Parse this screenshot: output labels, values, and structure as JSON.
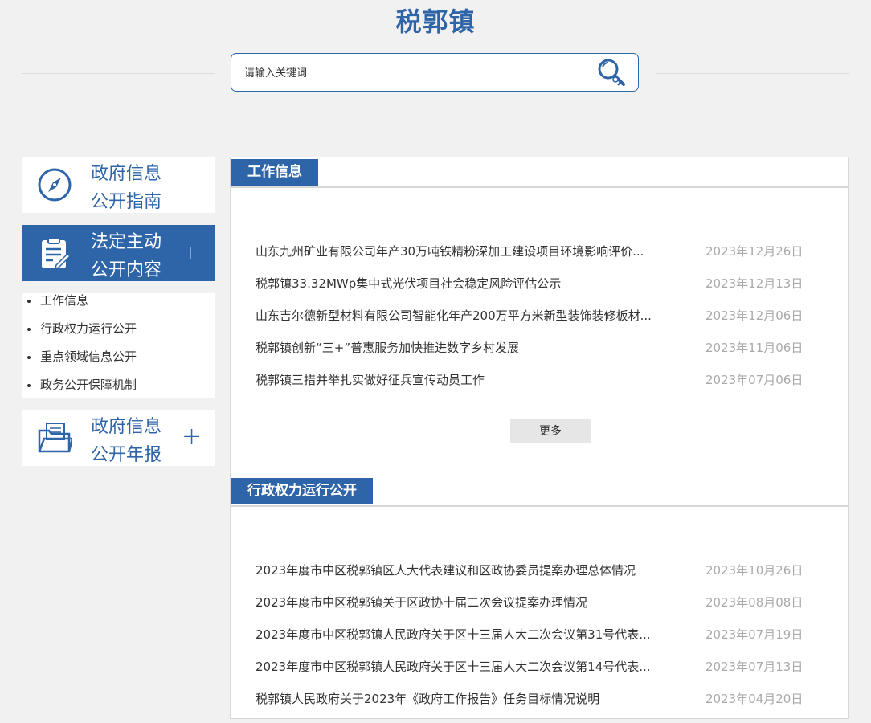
{
  "header": {
    "site_title": "税郭镇",
    "search_placeholder": "请输入关键词"
  },
  "sidebar": {
    "cards": [
      {
        "label_line1": "政府信息",
        "label_line2": "公开指南",
        "icon": "compass-icon"
      },
      {
        "label_line1": "法定主动",
        "label_line2": "公开内容",
        "icon": "clipboard-edit-icon",
        "active": true
      },
      {
        "label_line1": "政府信息",
        "label_line2": "公开年报",
        "icon": "folder-documents-icon",
        "expand": "+"
      }
    ],
    "sub_items": [
      "工作信息",
      "行政权力运行公开",
      "重点领域信息公开",
      "政务公开保障机制"
    ]
  },
  "sections": [
    {
      "title": "工作信息",
      "more_label": "更多",
      "items": [
        {
          "title": "山东九州矿业有限公司年产30万吨铁精粉深加工建设项目环境影响评价...",
          "date": "2023年12月26日"
        },
        {
          "title": "税郭镇33.32MWp集中式光伏项目社会稳定风险评估公示",
          "date": "2023年12月13日"
        },
        {
          "title": "山东吉尔德新型材料有限公司智能化年产200万平方米新型装饰装修板材...",
          "date": "2023年12月06日"
        },
        {
          "title": "税郭镇创新“三+”普惠服务加快推进数字乡村发展",
          "date": "2023年11月06日"
        },
        {
          "title": "税郭镇三措并举扎实做好征兵宣传动员工作",
          "date": "2023年07月06日"
        }
      ]
    },
    {
      "title": "行政权力运行公开",
      "items": [
        {
          "title": "2023年度市中区税郭镇区人大代表建议和区政协委员提案办理总体情况",
          "date": "2023年10月26日"
        },
        {
          "title": "2023年度市中区税郭镇关于区政协十届二次会议提案办理情况",
          "date": "2023年08月08日"
        },
        {
          "title": "2023年度市中区税郭镇人民政府关于区十三届人大二次会议第31号代表...",
          "date": "2023年07月19日"
        },
        {
          "title": "2023年度市中区税郭镇人民政府关于区十三届人大二次会议第14号代表...",
          "date": "2023年07月13日"
        },
        {
          "title": "税郭镇人民政府关于2023年《政府工作报告》任务目标情况说明",
          "date": "2023年04月20日"
        }
      ]
    }
  ],
  "colors": {
    "brand": "#2e64a8",
    "background": "#f1f1f1",
    "date_text": "#aaaaaa"
  }
}
